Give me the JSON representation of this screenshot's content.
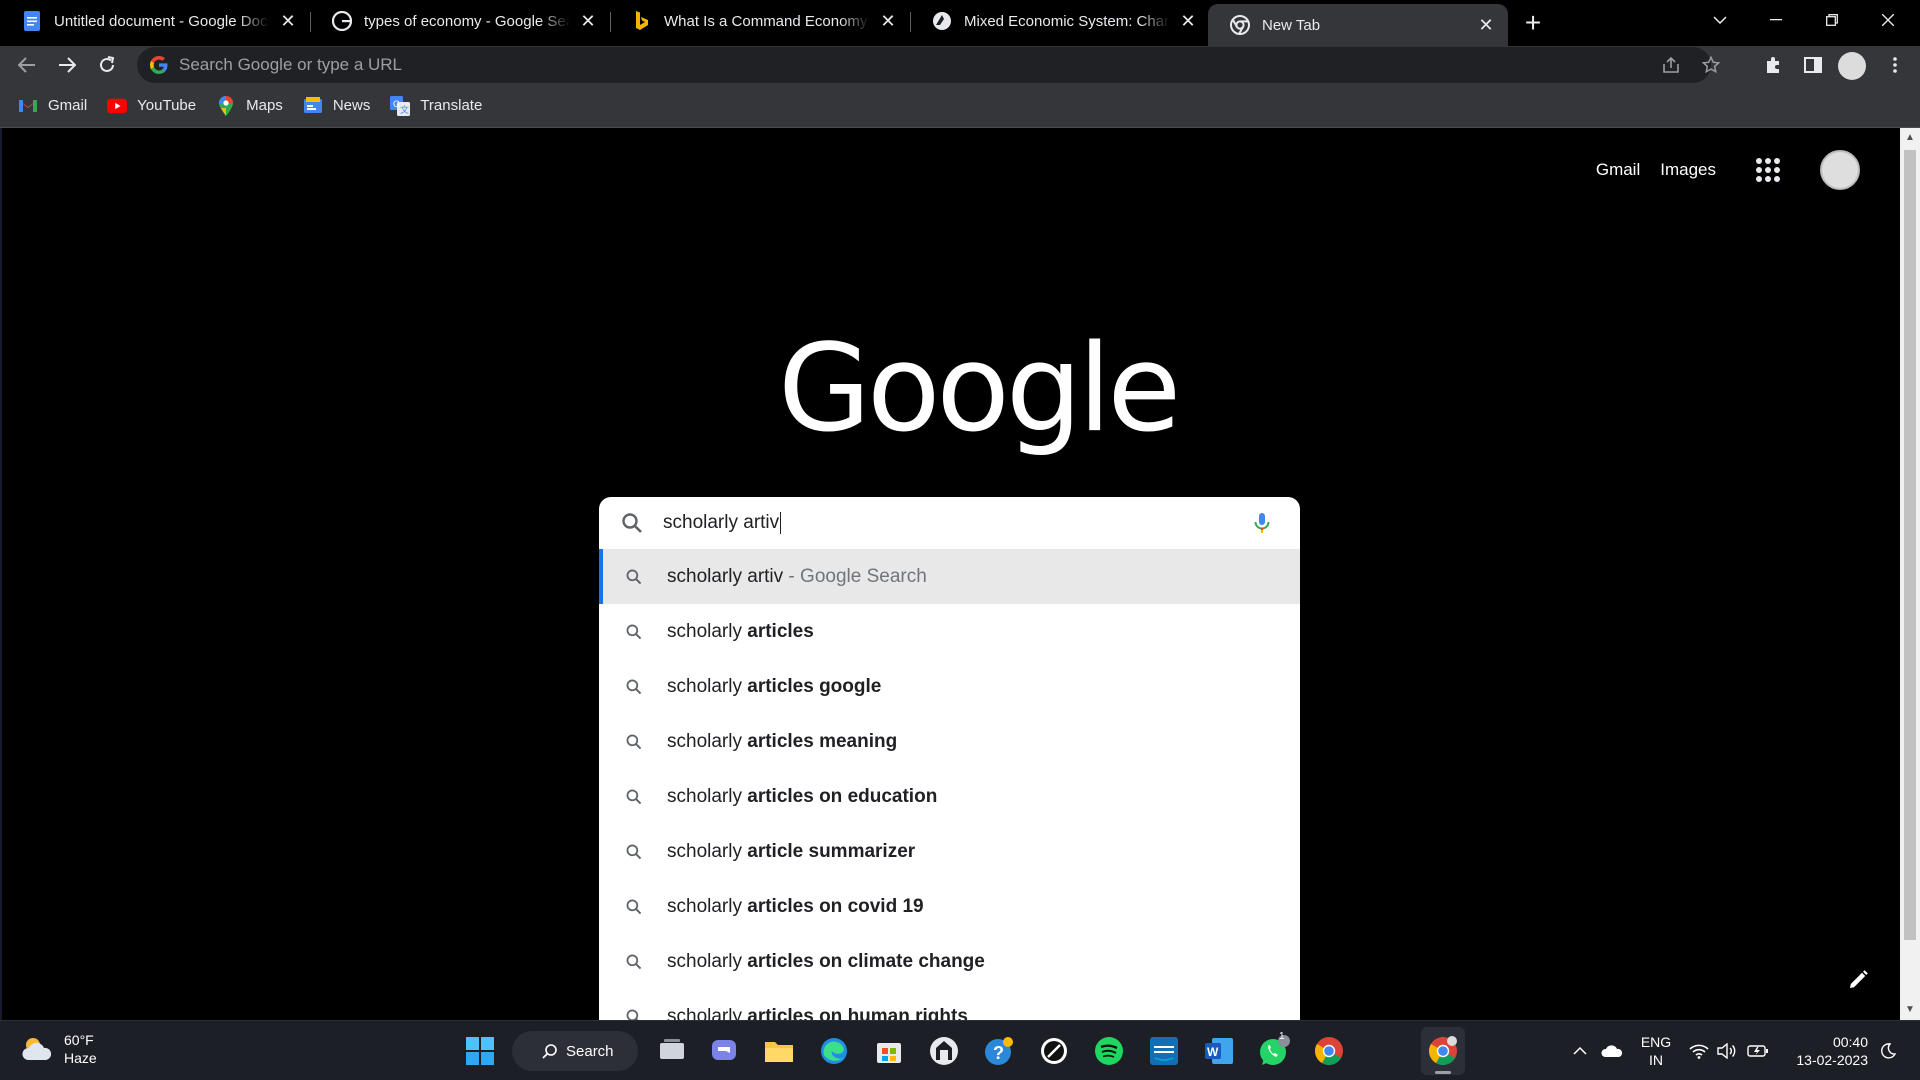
{
  "tabs": [
    {
      "title": "Untitled document - Google Docs",
      "icon": "google-docs-icon"
    },
    {
      "title": "types of economy - Google Search",
      "icon": "google-g-icon"
    },
    {
      "title": "What Is a Command Economy?",
      "icon": "bing-icon"
    },
    {
      "title": "Mixed Economic System: Characteristics",
      "icon": "site-icon"
    },
    {
      "title": "New Tab",
      "icon": "chrome-icon"
    }
  ],
  "omnibox": {
    "placeholder": "Search Google or type a URL"
  },
  "bookmarks": [
    {
      "label": "Gmail"
    },
    {
      "label": "YouTube"
    },
    {
      "label": "Maps"
    },
    {
      "label": "News"
    },
    {
      "label": "Translate"
    }
  ],
  "header_links": {
    "gmail": "Gmail",
    "images": "Images"
  },
  "logo_text": "Google",
  "search": {
    "query": "scholarly artiv"
  },
  "suggestions": [
    {
      "prefix": "scholarly artiv",
      "bold": "",
      "suffix": " - Google Search"
    },
    {
      "prefix": "scholarly ",
      "bold": "articles",
      "suffix": ""
    },
    {
      "prefix": "scholarly ",
      "bold": "articles google",
      "suffix": ""
    },
    {
      "prefix": "scholarly ",
      "bold": "articles meaning",
      "suffix": ""
    },
    {
      "prefix": "scholarly ",
      "bold": "articles on education",
      "suffix": ""
    },
    {
      "prefix": "scholarly ",
      "bold": "article summarizer",
      "suffix": ""
    },
    {
      "prefix": "scholarly ",
      "bold": "articles on covid 19",
      "suffix": ""
    },
    {
      "prefix": "scholarly ",
      "bold": "articles on climate change",
      "suffix": ""
    },
    {
      "prefix": "scholarly ",
      "bold": "articles on human rights",
      "suffix": ""
    }
  ],
  "taskbar": {
    "weather_temp": "60°F",
    "weather_desc": "Haze",
    "search_label": "Search",
    "lang_1": "ENG",
    "lang_2": "IN",
    "time": "00:40",
    "date": "13-02-2023",
    "whatsapp_badge": "1"
  },
  "colors": {
    "accent": "#1a73e8",
    "tab_active": "#35363a",
    "taskbar": "#1c1f26"
  }
}
